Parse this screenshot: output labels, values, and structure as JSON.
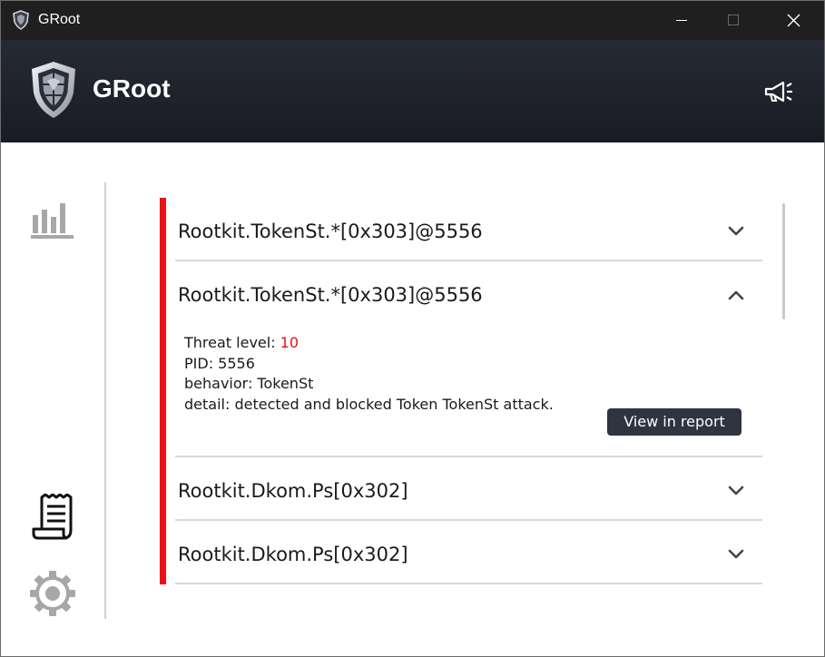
{
  "window": {
    "title": "GRoot"
  },
  "header": {
    "app_name": "GRoot"
  },
  "sidebar": {
    "items": [
      {
        "name": "statistics",
        "icon": "bar-chart-icon"
      },
      {
        "name": "report",
        "icon": "receipt-report-icon"
      },
      {
        "name": "settings",
        "icon": "gear-icon"
      }
    ]
  },
  "detections": [
    {
      "title": "Rootkit.TokenSt.*[0x303]@5556",
      "expanded": false
    },
    {
      "title": "Rootkit.TokenSt.*[0x303]@5556",
      "expanded": true,
      "threat_label": "Threat level: ",
      "threat_value": "10",
      "pid": "PID: 5556",
      "behavior": "behavior: TokenSt",
      "detail": "detail: detected and blocked Token TokenSt attack.",
      "button": "View in report"
    },
    {
      "title": "Rootkit.Dkom.Ps[0x302]",
      "expanded": false
    },
    {
      "title": "Rootkit.Dkom.Ps[0x302]",
      "expanded": false
    }
  ],
  "colors": {
    "accent": "#ee1111",
    "header_bg": "#20232c",
    "button_bg": "#2e3440"
  }
}
